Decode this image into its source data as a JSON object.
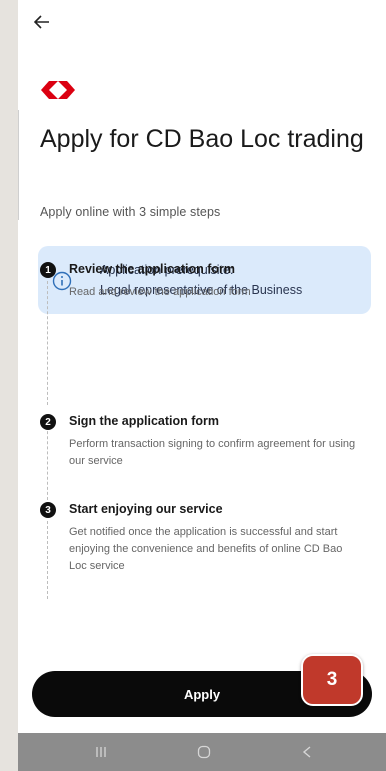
{
  "header": {
    "back_icon": "arrow-left-icon",
    "logo_icon": "hsbc-hexagon-logo",
    "brand_color": "#db0011"
  },
  "page": {
    "title": "Apply for CD Bao Loc trading",
    "subtitle": "Apply online with 3 simple steps"
  },
  "prerequisite": {
    "icon": "info-icon",
    "title": "Application prerequisite:",
    "text": "Legal representative of the Business",
    "background": "#dbeafb"
  },
  "steps": [
    {
      "number": "1",
      "title": "Review the application form",
      "description": "Read and review the application form"
    },
    {
      "number": "2",
      "title": "Sign the application form",
      "description": "Perform transaction signing to confirm agreement for using our service"
    },
    {
      "number": "3",
      "title": "Start enjoying our service",
      "description": "Get notified once the application is successful and start enjoying the convenience and benefits of online CD Bao Loc service"
    }
  ],
  "apply_button": {
    "label": "Apply"
  },
  "annotation_badge": {
    "label": "3",
    "color": "#c0392b"
  },
  "navbar": {
    "recents_icon": "recents-icon",
    "home_icon": "home-icon",
    "back_icon": "nav-back-icon",
    "color": "#8c8c8c"
  }
}
